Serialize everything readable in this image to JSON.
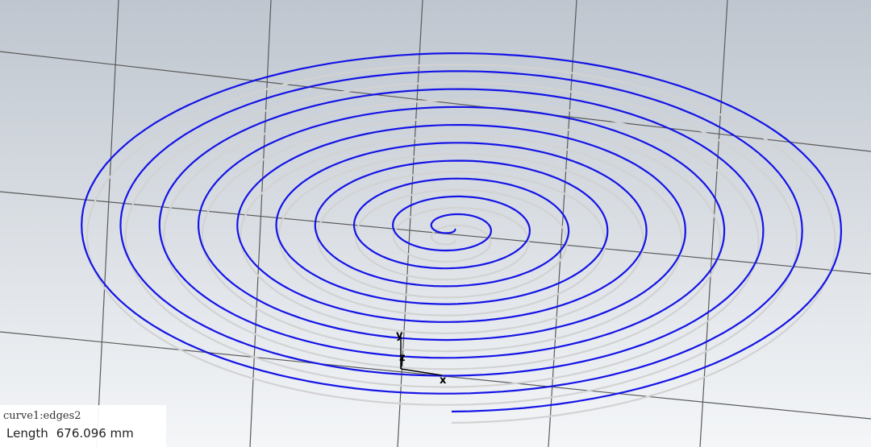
{
  "viewport": {
    "background_top": "#bfc6cf",
    "background_bottom": "#f4f6f8",
    "grid_color": "#5a5a5a",
    "curve_color": "#1414e6",
    "shadow_curve_color": "#d2d2d2"
  },
  "axes": {
    "x_label": "x",
    "y_label": "y",
    "z_label": "z"
  },
  "info": {
    "curve_name": "curve1:edges2",
    "length_label": "Length",
    "length_value": "676.096 mm"
  }
}
